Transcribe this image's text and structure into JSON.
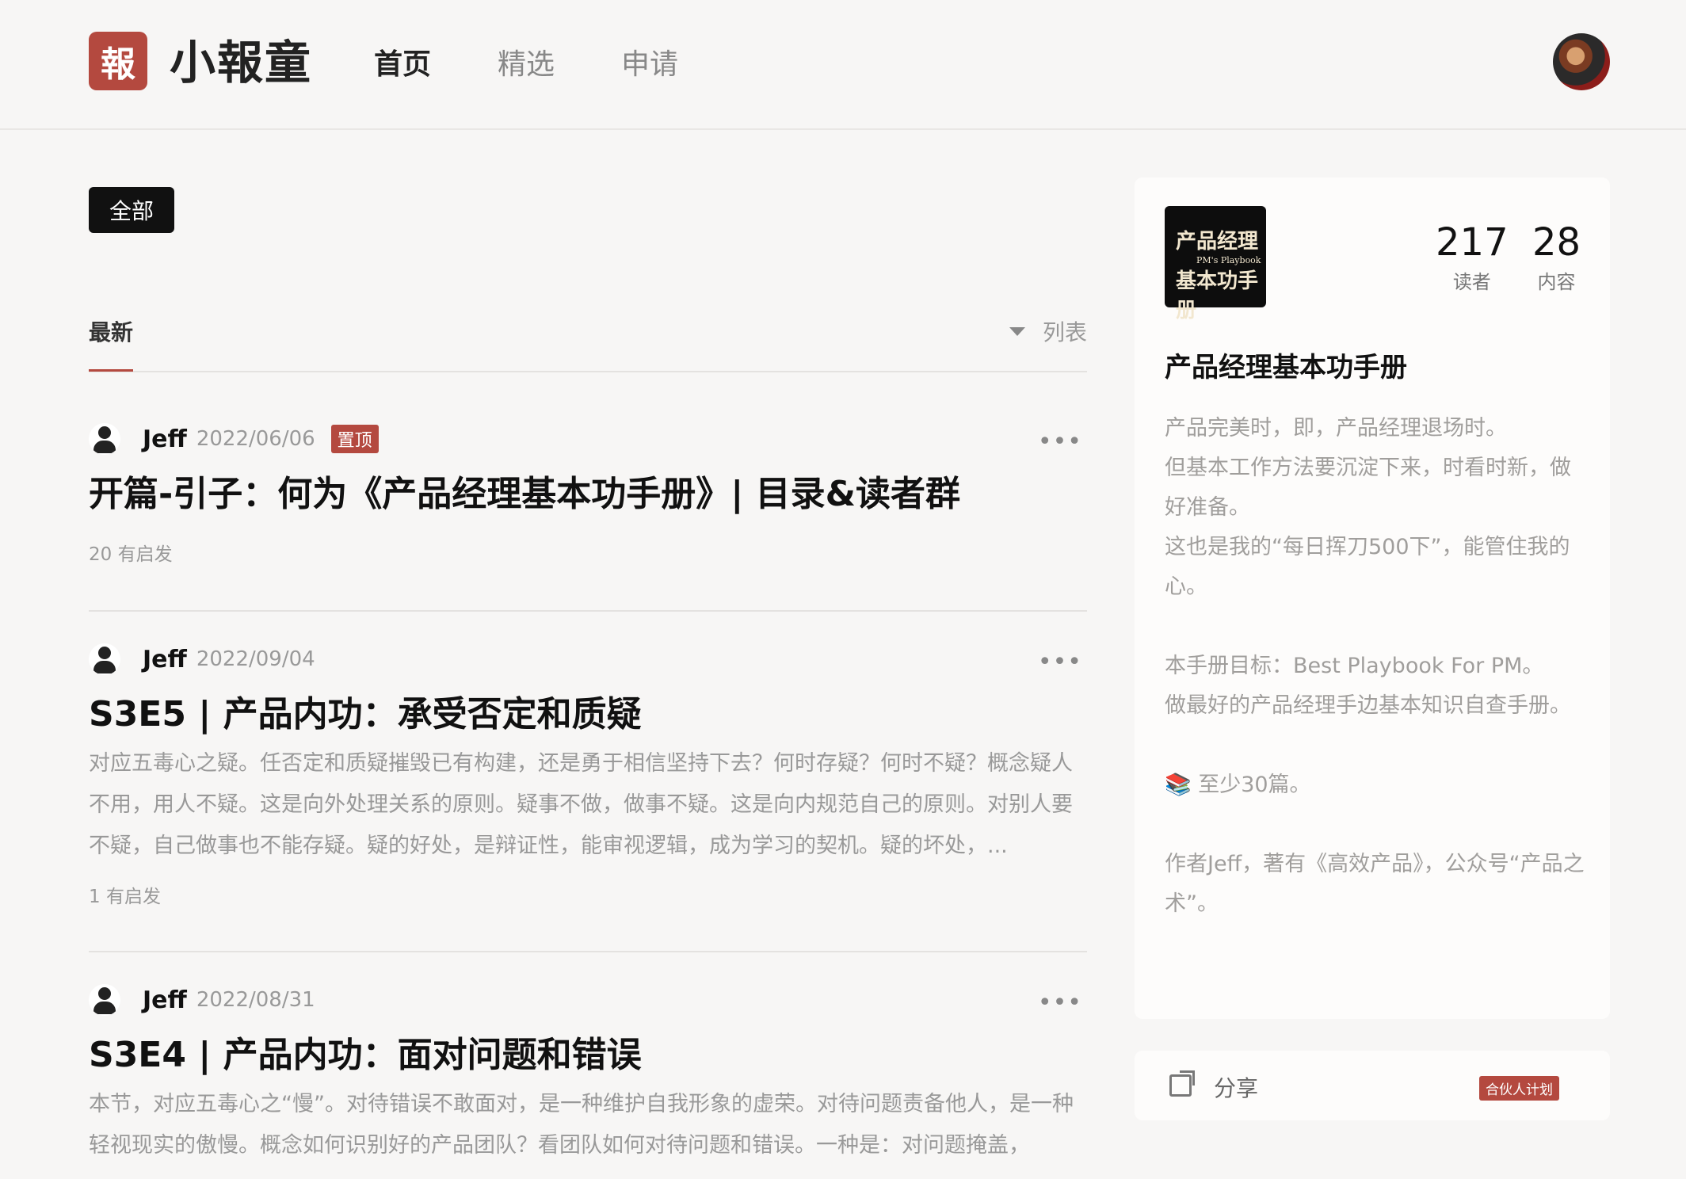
{
  "header": {
    "logo_char": "報",
    "brand": "小報童",
    "nav": [
      "首页",
      "精选",
      "申请"
    ],
    "active_nav": 0
  },
  "filter": {
    "all_label": "全部"
  },
  "tabs": {
    "latest": "最新",
    "view": "列表"
  },
  "posts": [
    {
      "author": "Jeff",
      "date": "2022/06/06",
      "badge": "置顶",
      "title": "开篇-引子：何为《产品经理基本功手册》| 目录&读者群",
      "excerpt": "",
      "foot": "20 有启发"
    },
    {
      "author": "Jeff",
      "date": "2022/09/04",
      "badge": "",
      "title": "S3E5 | 产品内功：承受否定和质疑",
      "excerpt": "对应五毒心之疑。任否定和质疑摧毁已有构建，还是勇于相信坚持下去？何时存疑？何时不疑？概念疑人不用，用人不疑。这是向外处理关系的原则。疑事不做，做事不疑。这是向内规范自己的原则。对别人要不疑，自己做事也不能存疑。疑的好处，是辩证性，能审视逻辑，成为学习的契机。疑的坏处，...",
      "foot": "1 有启发"
    },
    {
      "author": "Jeff",
      "date": "2022/08/31",
      "badge": "",
      "title": "S3E4 | 产品内功：面对问题和错误",
      "excerpt": "本节，对应五毒心之“慢”。对待错误不敢面对，是一种维护自我形象的虚荣。对待问题责备他人，是一种轻视现实的傲慢。概念如何识别好的产品团队？看团队如何对待问题和错误。一种是：对问题掩盖，",
      "foot": ""
    }
  ],
  "sidebar": {
    "cover_line1": "产品经理",
    "cover_sub": "PM's Playbook",
    "cover_line2": "基本功手册",
    "readers_num": "217",
    "readers_label": "读者",
    "content_num": "28",
    "content_label": "内容",
    "title": "产品经理基本功手册",
    "desc": [
      "产品完美时，即，产品经理退场时。",
      "但基本工作方法要沉淀下来，时看时新，做好准备。",
      "这也是我的“每日挥刀500下”，能管住我的心。",
      "",
      "本手册目标：Best Playbook For PM。",
      "做最好的产品经理手边基本知识自查手册。",
      "",
      "📚 至少30篇。",
      "",
      "作者Jeff，著有《高效产品》，公众号“产品之术”。"
    ],
    "share_label": "分享",
    "partner_label": "合伙人计划"
  }
}
